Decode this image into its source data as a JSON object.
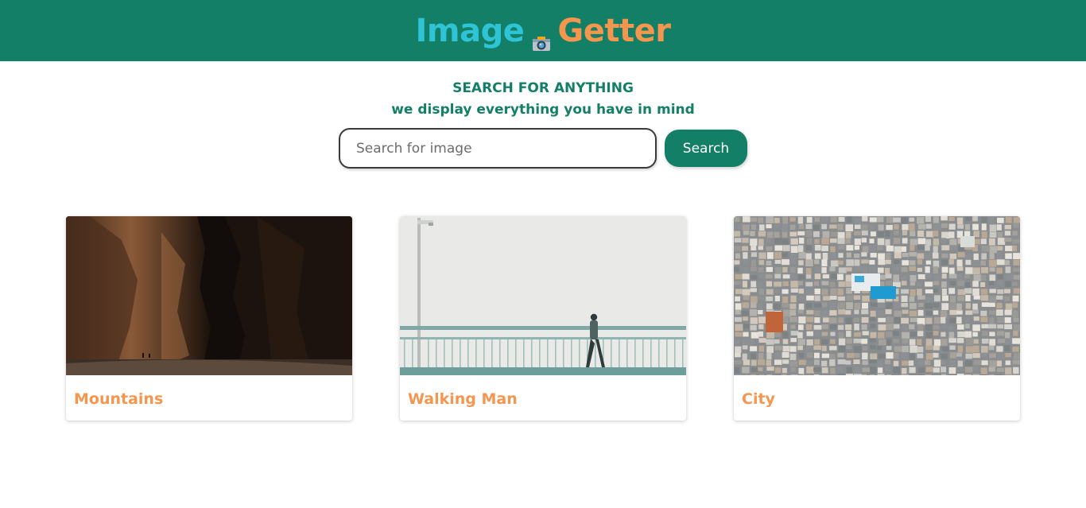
{
  "header": {
    "logo_part1": "Image",
    "logo_part2": "Getter",
    "logo_icon": "camera-icon",
    "background_color": "#137f66",
    "logo_color1": "#2ec4d6",
    "logo_color2": "#f5964f"
  },
  "tagline": {
    "line1": "SEARCH FOR ANYTHING",
    "line2": "we display everything you have in mind"
  },
  "search": {
    "placeholder": "Search for image",
    "value": "",
    "button_label": "Search"
  },
  "results": [
    {
      "title": "Mountains"
    },
    {
      "title": "Walking Man"
    },
    {
      "title": "City"
    }
  ]
}
